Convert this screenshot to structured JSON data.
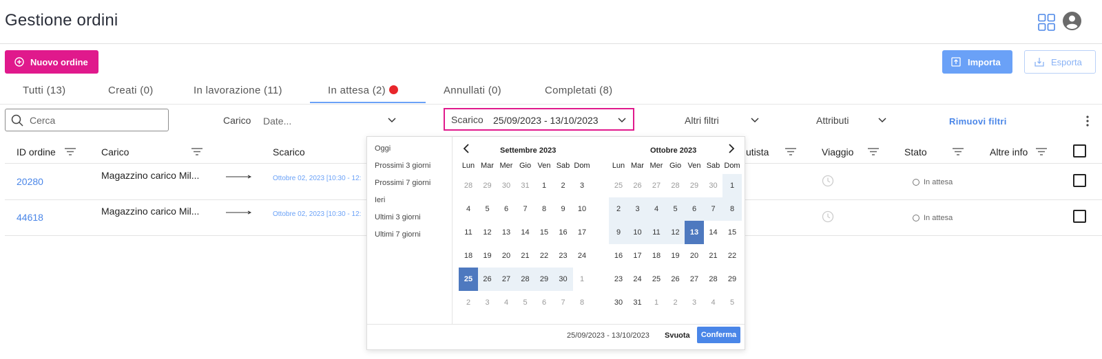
{
  "header": {
    "title": "Gestione ordini"
  },
  "toolbar": {
    "new_order_label": "Nuovo ordine",
    "import_label": "Importa",
    "export_label": "Esporta"
  },
  "tabs": [
    {
      "label": "Tutti (13)"
    },
    {
      "label": "Creati (0)"
    },
    {
      "label": "In lavorazione (11)"
    },
    {
      "label": "In attesa (2)",
      "active": true
    },
    {
      "label": "Annullati (0)"
    },
    {
      "label": "Completati (8)"
    }
  ],
  "filters": {
    "search_placeholder": "Cerca",
    "carico_label": "Carico",
    "carico_value": "Date...",
    "scarico_label": "Scarico",
    "scarico_value": "25/09/2023 - 13/10/2023",
    "altri_filtri": "Altri filtri",
    "attributi": "Attributi",
    "remove_filters": "Rimuovi filtri"
  },
  "table": {
    "headers": {
      "id": "ID ordine",
      "carico": "Carico",
      "scarico": "Scarico",
      "autista": "utista",
      "viaggio": "Viaggio",
      "stato": "Stato",
      "altre_info": "Altre info"
    },
    "rows": [
      {
        "id": "20280",
        "carico": "Magazzino carico Mil...",
        "scarico": "Ottobre 02, 2023 [10:30 - 12:",
        "stato": "In attesa"
      },
      {
        "id": "44618",
        "carico": "Magazzino carico Mil...",
        "scarico": "Ottobre 02, 2023 [10:30 - 12:",
        "stato": "In attesa"
      }
    ]
  },
  "datepicker": {
    "presets": [
      "Oggi",
      "Prossimi 3 giorni",
      "Prossimi 7 giorni",
      "Ieri",
      "Ultimi 3 giorni",
      "Ultimi 7 giorni"
    ],
    "weekdays": [
      "Lun",
      "Mar",
      "Mer",
      "Gio",
      "Ven",
      "Sab",
      "Dom"
    ],
    "months": [
      {
        "title": "Settembre 2023",
        "weeks": [
          [
            "28",
            "29",
            "30",
            "31",
            "1",
            "2",
            "3"
          ],
          [
            "4",
            "5",
            "6",
            "7",
            "8",
            "9",
            "10"
          ],
          [
            "11",
            "12",
            "13",
            "14",
            "15",
            "16",
            "17"
          ],
          [
            "18",
            "19",
            "20",
            "21",
            "22",
            "23",
            "24"
          ],
          [
            "25",
            "26",
            "27",
            "28",
            "29",
            "30",
            "1"
          ],
          [
            "2",
            "3",
            "4",
            "5",
            "6",
            "7",
            "8"
          ]
        ]
      },
      {
        "title": "Ottobre 2023",
        "weeks": [
          [
            "25",
            "26",
            "27",
            "28",
            "29",
            "30",
            "1"
          ],
          [
            "2",
            "3",
            "4",
            "5",
            "6",
            "7",
            "8"
          ],
          [
            "9",
            "10",
            "11",
            "12",
            "13",
            "14",
            "15"
          ],
          [
            "16",
            "17",
            "18",
            "19",
            "20",
            "21",
            "22"
          ],
          [
            "23",
            "24",
            "25",
            "26",
            "27",
            "28",
            "29"
          ],
          [
            "30",
            "31",
            "1",
            "2",
            "3",
            "4",
            "5"
          ]
        ]
      }
    ],
    "selected_range": "25/09/2023 - 13/10/2023",
    "clear_label": "Svuota",
    "confirm_label": "Conferma"
  },
  "colors": {
    "brand_pink": "#e0198c",
    "primary_blue": "#4a86e8",
    "selected_day": "#4e79bf",
    "range_fill": "#eaf1f7",
    "alert_dot": "#e8262b"
  },
  "icons": [
    "plus-circle-icon",
    "upload-icon",
    "download-icon",
    "search-icon",
    "chevron-down-icon",
    "filter-icon",
    "clock-icon",
    "grid-apps-icon",
    "user-avatar-icon",
    "kebab-menu-icon",
    "chevron-left-icon",
    "chevron-right-icon"
  ]
}
